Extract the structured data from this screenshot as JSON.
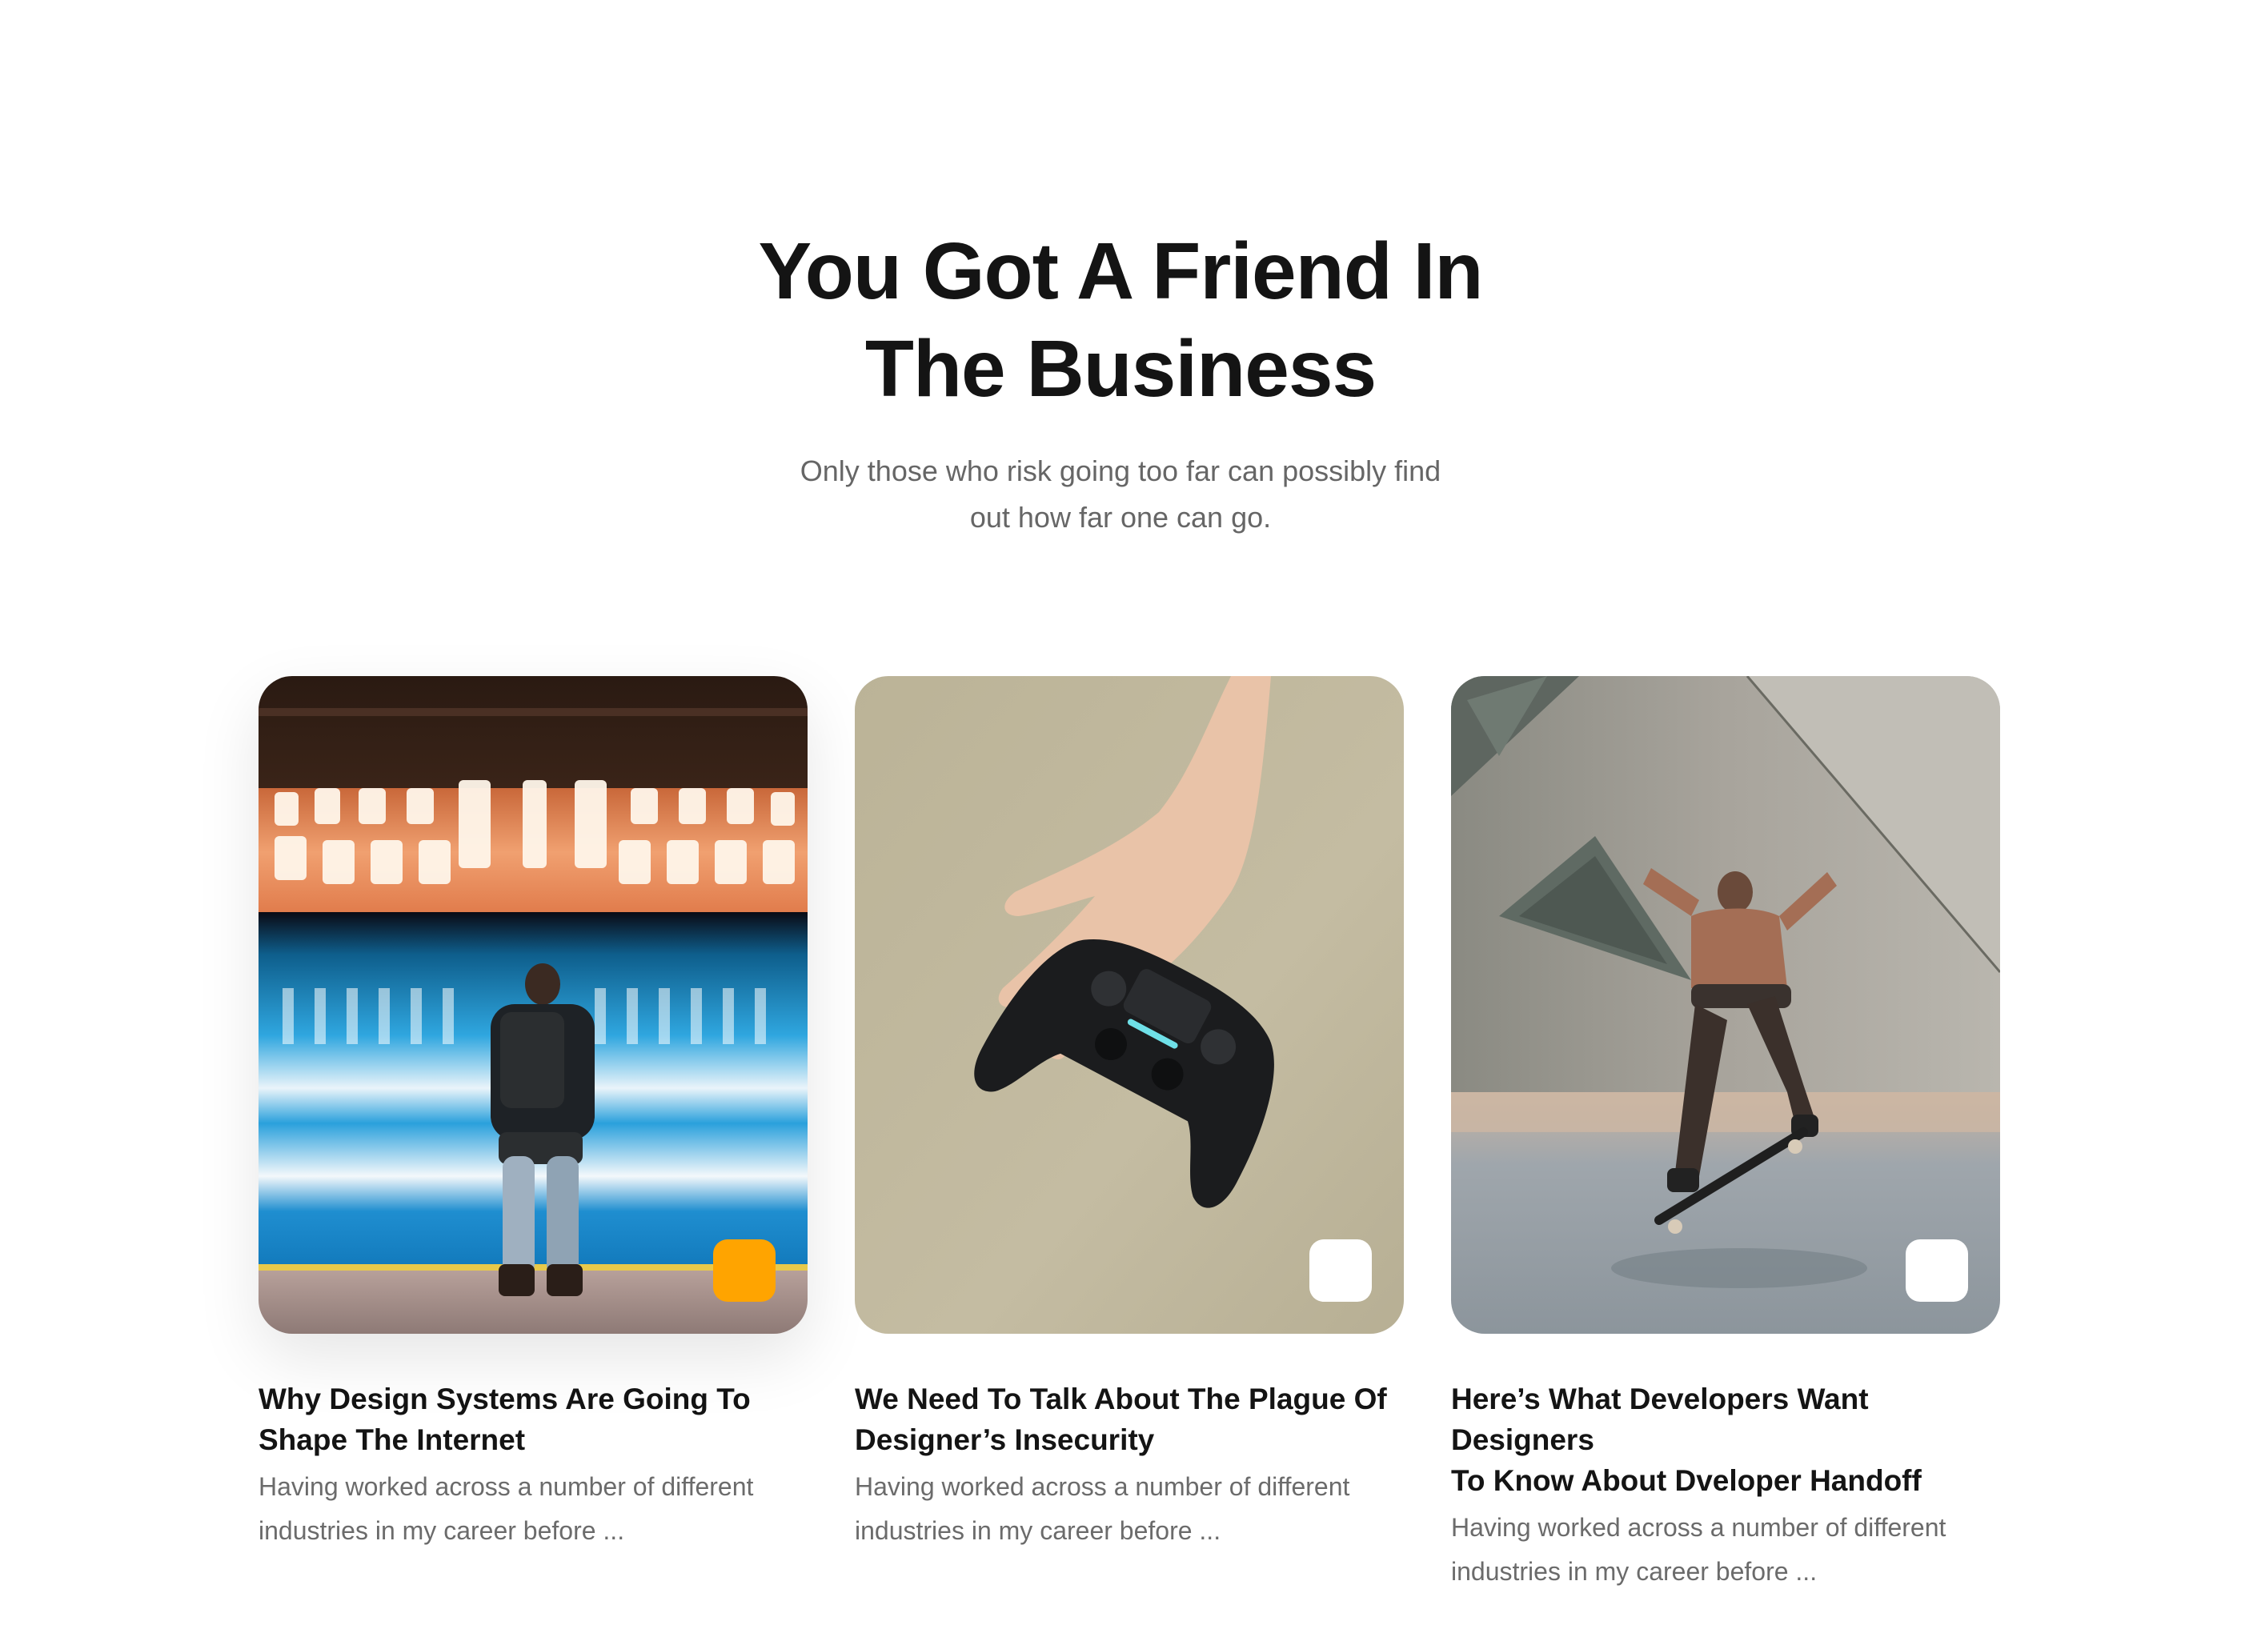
{
  "header": {
    "title_line1": "You Got A Friend In",
    "title_line2": "The Business",
    "subtitle_line1": "Only those who risk going too far can possibly find",
    "subtitle_line2": "out how far one can go."
  },
  "cards": [
    {
      "title_line1": "Why Design Systems Are Going To",
      "title_line2": "Shape The Internet",
      "excerpt_line1": "Having worked across a number of different",
      "excerpt_line2": "industries in my career before ...",
      "tag_color": "#FFA400",
      "image": "subway-platform-photo"
    },
    {
      "title_line1": "We Need To Talk About The Plague Of",
      "title_line2": "Designer’s Insecurity",
      "excerpt_line1": "Having worked across a number of different",
      "excerpt_line2": "industries in my career before ...",
      "tag_color": "#FFFFFF",
      "image": "hand-holding-game-controller-photo"
    },
    {
      "title_line1": "Here’s What Developers Want Designers",
      "title_line2": "To Know About Dveloper Handoff",
      "excerpt_line1": "Having worked across a number of different",
      "excerpt_line2": "industries in my career before ...",
      "tag_color": "#FFFFFF",
      "image": "skateboarder-jumping-photo"
    }
  ],
  "colors": {
    "heading": "#141414",
    "body_text": "#666666",
    "accent": "#FFA400",
    "background": "#FFFFFF"
  }
}
